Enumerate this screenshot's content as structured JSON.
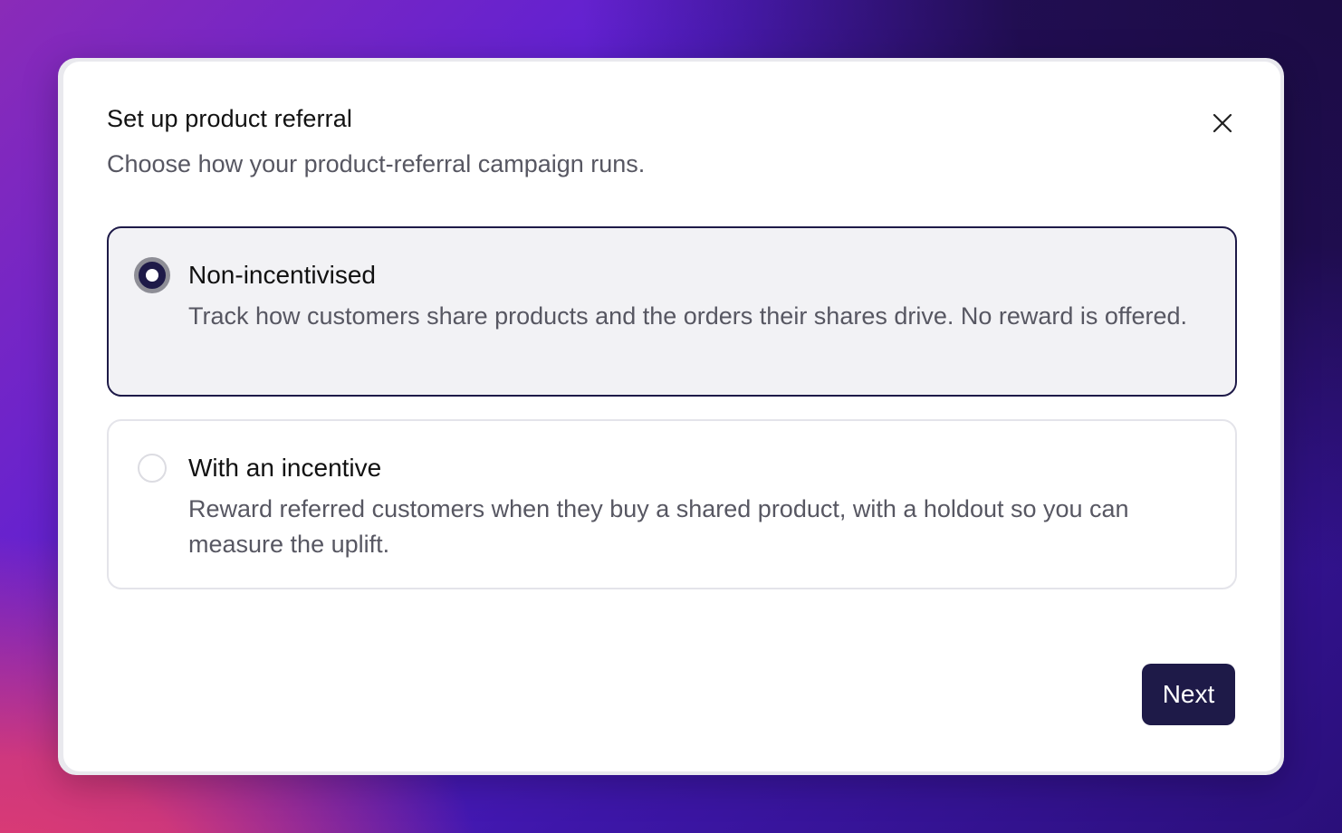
{
  "dialog": {
    "title": "Set up product referral",
    "subtitle": "Choose how your product-referral campaign runs.",
    "close_icon": "close-icon",
    "options": [
      {
        "title": "Non-incentivised",
        "description": "Track how customers share products and the orders their shares drive. No reward is offered.",
        "selected": true
      },
      {
        "title": "With an incentive",
        "description": "Reward referred customers when they buy a shared product, with a holdout so you can measure the uplift.",
        "selected": false
      }
    ],
    "next_label": "Next"
  },
  "colors": {
    "accent": "#1e1a48",
    "selected_card_bg": "#f2f2f5",
    "muted_text": "#575762"
  }
}
